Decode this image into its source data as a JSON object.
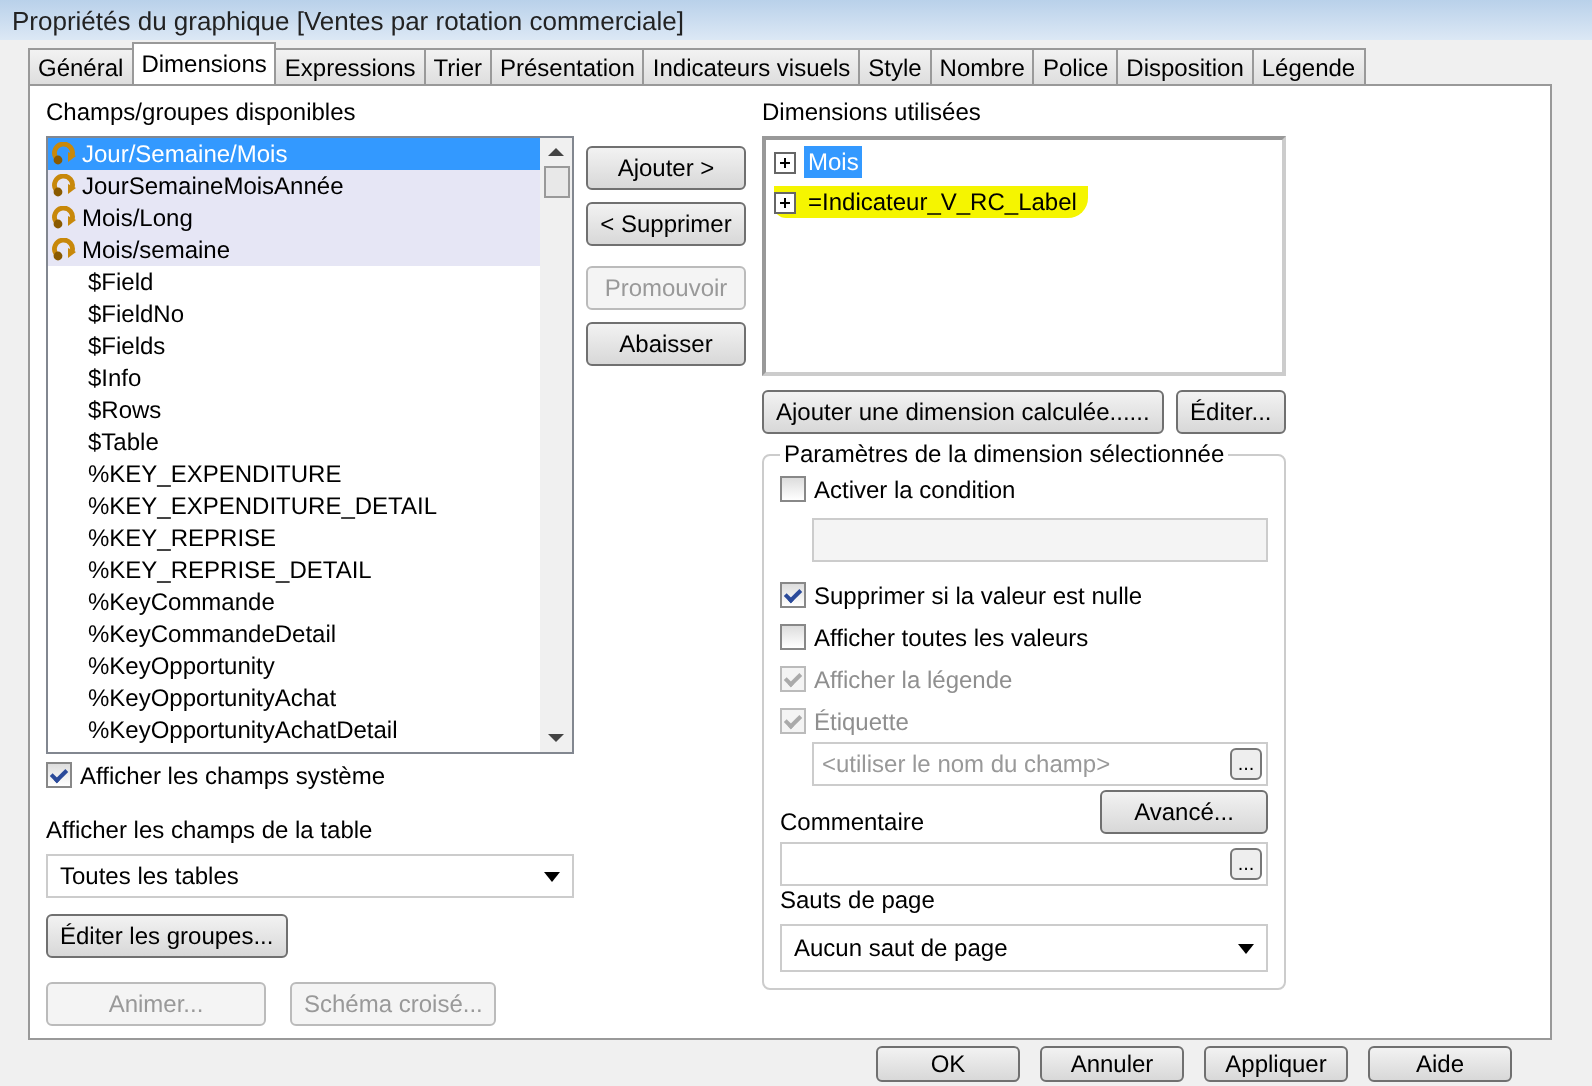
{
  "window": {
    "title": "Propriétés du graphique [Ventes par rotation commerciale]"
  },
  "tabs": [
    {
      "label": "Général",
      "selected": false
    },
    {
      "label": "Dimensions",
      "selected": true
    },
    {
      "label": "Expressions",
      "selected": false
    },
    {
      "label": "Trier",
      "selected": false
    },
    {
      "label": "Présentation",
      "selected": false
    },
    {
      "label": "Indicateurs visuels",
      "selected": false
    },
    {
      "label": "Style",
      "selected": false
    },
    {
      "label": "Nombre",
      "selected": false
    },
    {
      "label": "Police",
      "selected": false
    },
    {
      "label": "Disposition",
      "selected": false
    },
    {
      "label": "Légende",
      "selected": false
    }
  ],
  "available": {
    "label": "Champs/groupes disponibles",
    "items": [
      {
        "text": "Jour/Semaine/Mois",
        "kind": "group",
        "selected": true
      },
      {
        "text": "JourSemaineMoisAnnée",
        "kind": "group",
        "selected": false
      },
      {
        "text": "Mois/Long",
        "kind": "group",
        "selected": false
      },
      {
        "text": "Mois/semaine",
        "kind": "group",
        "selected": false
      },
      {
        "text": "$Field",
        "kind": "field",
        "selected": false
      },
      {
        "text": "$FieldNo",
        "kind": "field",
        "selected": false
      },
      {
        "text": "$Fields",
        "kind": "field",
        "selected": false
      },
      {
        "text": "$Info",
        "kind": "field",
        "selected": false
      },
      {
        "text": "$Rows",
        "kind": "field",
        "selected": false
      },
      {
        "text": "$Table",
        "kind": "field",
        "selected": false
      },
      {
        "text": "%KEY_EXPENDITURE",
        "kind": "field",
        "selected": false
      },
      {
        "text": "%KEY_EXPENDITURE_DETAIL",
        "kind": "field",
        "selected": false
      },
      {
        "text": "%KEY_REPRISE",
        "kind": "field",
        "selected": false
      },
      {
        "text": "%KEY_REPRISE_DETAIL",
        "kind": "field",
        "selected": false
      },
      {
        "text": "%KeyCommande",
        "kind": "field",
        "selected": false
      },
      {
        "text": "%KeyCommandeDetail",
        "kind": "field",
        "selected": false
      },
      {
        "text": "%KeyOpportunity",
        "kind": "field",
        "selected": false
      },
      {
        "text": "%KeyOpportunityAchat",
        "kind": "field",
        "selected": false
      },
      {
        "text": "%KeyOpportunityAchatDetail",
        "kind": "field",
        "selected": false
      }
    ]
  },
  "show_system": {
    "label": "Afficher les champs système",
    "checked": true
  },
  "table_filter": {
    "label": "Afficher les champs de la table",
    "value": "Toutes les tables"
  },
  "left_buttons": [
    {
      "label": "Éditer les groupes...",
      "disabled": false
    },
    {
      "label": "Animer...",
      "disabled": true
    },
    {
      "label": "Schéma croisé...",
      "disabled": true
    }
  ],
  "middle_buttons": [
    {
      "label": "Ajouter >",
      "disabled": false
    },
    {
      "label": "< Supprimer",
      "disabled": false
    },
    {
      "label": "Promouvoir",
      "disabled": true
    },
    {
      "label": "Abaisser",
      "disabled": false
    }
  ],
  "used": {
    "label": "Dimensions utilisées",
    "items": [
      {
        "text": "Mois",
        "selected": true,
        "highlighted": false
      },
      {
        "text": "=Indicateur_V_RC_Label",
        "selected": false,
        "highlighted": true
      }
    ]
  },
  "used_buttons": [
    {
      "label": "Ajouter une dimension calculée......"
    },
    {
      "label": "Éditer..."
    }
  ],
  "settings": {
    "legend": "Paramètres de la dimension sélectionnée",
    "condition": {
      "label": "Activer la condition",
      "checked": false,
      "disabled": false
    },
    "checks": [
      {
        "label": "Supprimer si la valeur est nulle",
        "checked": true,
        "disabled": false
      },
      {
        "label": "Afficher toutes les valeurs",
        "checked": false,
        "disabled": false
      },
      {
        "label": "Afficher la légende",
        "checked": true,
        "disabled": true
      },
      {
        "label": "Étiquette",
        "checked": true,
        "disabled": true
      }
    ],
    "label_placeholder": "<utiliser le nom du champ>",
    "ellipsis": "...",
    "advanced": "Avancé...",
    "comment_label": "Commentaire",
    "comment_ellipsis": "...",
    "page_break_label": "Sauts de page",
    "page_break_value": "Aucun saut de page"
  },
  "dialog_buttons": [
    "OK",
    "Annuler",
    "Appliquer",
    "Aide"
  ]
}
